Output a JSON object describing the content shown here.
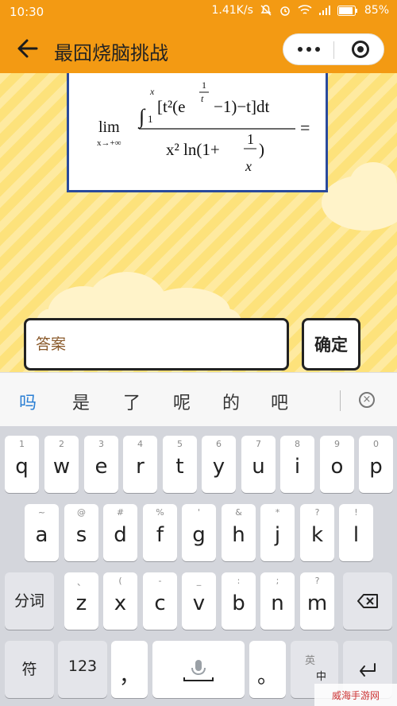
{
  "status": {
    "time": "10:30",
    "speed": "1.41K/s",
    "battery": "85%"
  },
  "nav": {
    "title": "最囧烧脑挑战"
  },
  "formula": {
    "lim": "lim",
    "limsub": "x→+∞",
    "upper": "x",
    "lower": "1",
    "integrand": "[t²(e",
    "exp_num": "1",
    "exp_den": "t",
    "integrand_tail": "−1)−t]dt",
    "denominator": "x² ln(1+",
    "frac_num": "1",
    "frac_den": "x",
    "den_tail": ")",
    "equals": "="
  },
  "answer": {
    "placeholder": "答案",
    "confirm_label": "确定"
  },
  "candidates": [
    "吗",
    "是",
    "了",
    "呢",
    "的",
    "吧"
  ],
  "keyboard": {
    "row1": [
      {
        "sub": "1",
        "main": "q"
      },
      {
        "sub": "2",
        "main": "w"
      },
      {
        "sub": "3",
        "main": "e"
      },
      {
        "sub": "4",
        "main": "r"
      },
      {
        "sub": "5",
        "main": "t"
      },
      {
        "sub": "6",
        "main": "y"
      },
      {
        "sub": "7",
        "main": "u"
      },
      {
        "sub": "8",
        "main": "i"
      },
      {
        "sub": "9",
        "main": "o"
      },
      {
        "sub": "0",
        "main": "p"
      }
    ],
    "row2": [
      {
        "sub": "~",
        "main": "a"
      },
      {
        "sub": "@",
        "main": "s"
      },
      {
        "sub": "#",
        "main": "d"
      },
      {
        "sub": "%",
        "main": "f"
      },
      {
        "sub": "'",
        "main": "g"
      },
      {
        "sub": "&",
        "main": "h"
      },
      {
        "sub": "*",
        "main": "j"
      },
      {
        "sub": "?",
        "main": "k"
      },
      {
        "sub": "!",
        "main": "l"
      }
    ],
    "row3": [
      {
        "sub": "、",
        "main": "z"
      },
      {
        "sub": "(",
        "main": "x"
      },
      {
        "sub": "-",
        "main": "c"
      },
      {
        "sub": "_",
        "main": "v"
      },
      {
        "sub": ":",
        "main": "b"
      },
      {
        "sub": ";",
        "main": "n"
      },
      {
        "sub": "?",
        "main": "m"
      }
    ],
    "fenci": "分词",
    "fu": "符",
    "num": "123",
    "comma": "，",
    "period": "。",
    "lang_top": "英",
    "lang_bottom": "中"
  },
  "watermark": "威海手游网"
}
